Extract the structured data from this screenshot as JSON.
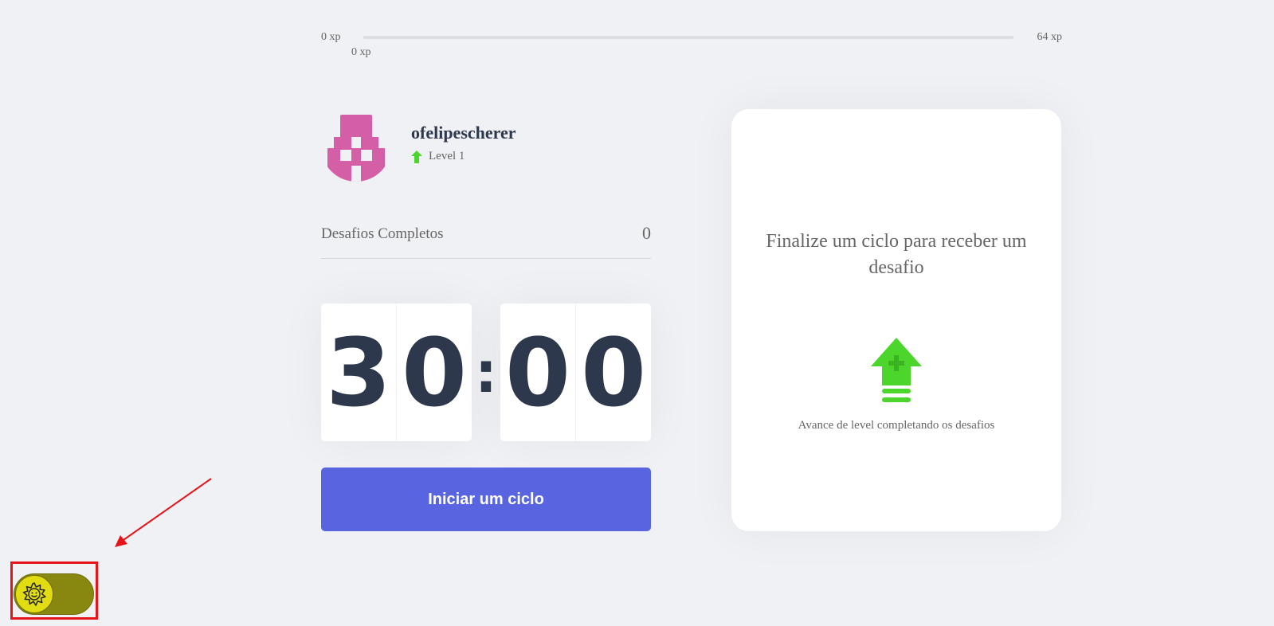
{
  "xp": {
    "min_label": "0 xp",
    "max_label": "64 xp",
    "current_label": "0 xp",
    "progress": 0
  },
  "profile": {
    "username": "ofelipescherer",
    "level_label": "Level 1",
    "avatar_icon": "pixel-avatar-icon",
    "avatar_color": "#d45fa6",
    "level_icon": "level-up-arrow-icon"
  },
  "completed_challenges": {
    "label": "Desafios Completos",
    "value": "0"
  },
  "countdown": {
    "minute_left": "3",
    "minute_right": "0",
    "separator": ":",
    "second_left": "0",
    "second_right": "0"
  },
  "start_button": {
    "label": "Iniciar um ciclo",
    "color": "#5965e0"
  },
  "challenge_box": {
    "title": "Finalize um ciclo para receber um desafio",
    "icon": "level-up-icon",
    "hint": "Avance de level completando os desafios",
    "accent": "#4cd62b"
  },
  "theme_toggle": {
    "icon": "sun-icon",
    "track_color": "#888710",
    "knob_color": "#e2dc13"
  },
  "annotation": {
    "color": "#e5141a"
  }
}
